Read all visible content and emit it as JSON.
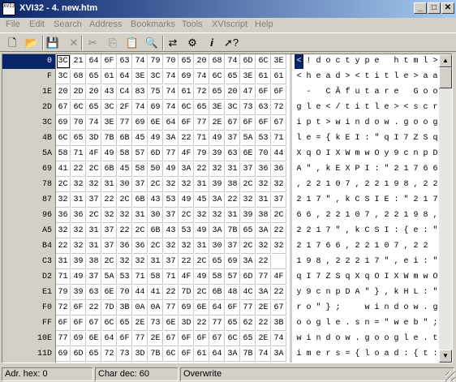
{
  "window": {
    "title": "XVI32 - 4. new.htm",
    "icon_text": "XVI32",
    "minimize_glyph": "_",
    "maximize_glyph": "□",
    "close_glyph": "✕"
  },
  "menu": [
    "File",
    "Edit",
    "Search",
    "Address",
    "Bookmarks",
    "Tools",
    "XVIscript",
    "Help"
  ],
  "toolbar": [
    {
      "name": "new-file-icon",
      "glyph": "🗋",
      "enabled": true
    },
    {
      "name": "open-folder-icon",
      "glyph": "📂",
      "enabled": true
    },
    {
      "name": "save-icon",
      "glyph": "💾",
      "enabled": true
    },
    {
      "name": "close-file-icon",
      "glyph": "✕",
      "enabled": false
    },
    {
      "name": "cut-icon",
      "glyph": "✂",
      "enabled": false
    },
    {
      "name": "copy-icon",
      "glyph": "⎘",
      "enabled": false
    },
    {
      "name": "paste-icon",
      "glyph": "📋",
      "enabled": true
    },
    {
      "name": "find-icon",
      "glyph": "🔍",
      "enabled": true
    },
    {
      "name": "replace-icon",
      "glyph": "⇄",
      "enabled": true
    },
    {
      "name": "settings-icon",
      "glyph": "⚙",
      "enabled": true
    },
    {
      "name": "info-icon",
      "glyph": "𝒊",
      "enabled": true
    },
    {
      "name": "context-help-icon",
      "glyph": "➚?",
      "enabled": true
    }
  ],
  "selection": {
    "row": 0,
    "col": 0
  },
  "rows": [
    {
      "addr": "0",
      "hex": [
        "3C",
        "21",
        "64",
        "6F",
        "63",
        "74",
        "79",
        "70",
        "65",
        "20",
        "68",
        "74",
        "6D",
        "6C",
        "3E"
      ],
      "text": [
        "<",
        "!",
        "d",
        "o",
        "c",
        "t",
        "y",
        "p",
        "e",
        " ",
        "h",
        "t",
        "m",
        "l",
        ">"
      ]
    },
    {
      "addr": "F",
      "hex": [
        "3C",
        "68",
        "65",
        "61",
        "64",
        "3E",
        "3C",
        "74",
        "69",
        "74",
        "6C",
        "65",
        "3E",
        "61",
        "61"
      ],
      "text": [
        "<",
        "h",
        "e",
        "a",
        "d",
        ">",
        "<",
        "t",
        "i",
        "t",
        "l",
        "e",
        ">",
        "a",
        "a"
      ]
    },
    {
      "addr": "1E",
      "hex": [
        "20",
        "2D",
        "20",
        "43",
        "C4",
        "83",
        "75",
        "74",
        "61",
        "72",
        "65",
        "20",
        "47",
        "6F",
        "6F"
      ],
      "text": [
        " ",
        "-",
        " ",
        "C",
        "Ă",
        "f",
        "u",
        "t",
        "a",
        "r",
        "e",
        " ",
        "G",
        "o",
        "o"
      ]
    },
    {
      "addr": "2D",
      "hex": [
        "67",
        "6C",
        "65",
        "3C",
        "2F",
        "74",
        "69",
        "74",
        "6C",
        "65",
        "3E",
        "3C",
        "73",
        "63",
        "72"
      ],
      "text": [
        "g",
        "l",
        "e",
        "<",
        "/",
        "t",
        "i",
        "t",
        "l",
        "e",
        ">",
        "<",
        "s",
        "c",
        "r"
      ]
    },
    {
      "addr": "3C",
      "hex": [
        "69",
        "70",
        "74",
        "3E",
        "77",
        "69",
        "6E",
        "64",
        "6F",
        "77",
        "2E",
        "67",
        "6F",
        "6F",
        "67"
      ],
      "text": [
        "i",
        "p",
        "t",
        ">",
        "w",
        "i",
        "n",
        "d",
        "o",
        "w",
        ".",
        "g",
        "o",
        "o",
        "g"
      ]
    },
    {
      "addr": "4B",
      "hex": [
        "6C",
        "65",
        "3D",
        "7B",
        "6B",
        "45",
        "49",
        "3A",
        "22",
        "71",
        "49",
        "37",
        "5A",
        "53",
        "71"
      ],
      "text": [
        "l",
        "e",
        "=",
        "{",
        "k",
        "E",
        "I",
        ":",
        "\"",
        "q",
        "I",
        "7",
        "Z",
        "S",
        "q"
      ]
    },
    {
      "addr": "5A",
      "hex": [
        "58",
        "71",
        "4F",
        "49",
        "58",
        "57",
        "6D",
        "77",
        "4F",
        "79",
        "39",
        "63",
        "6E",
        "70",
        "44"
      ],
      "text": [
        "X",
        "q",
        "O",
        "I",
        "X",
        "W",
        "m",
        "w",
        "O",
        "y",
        "9",
        "c",
        "n",
        "p",
        "D"
      ]
    },
    {
      "addr": "69",
      "hex": [
        "41",
        "22",
        "2C",
        "6B",
        "45",
        "58",
        "50",
        "49",
        "3A",
        "22",
        "32",
        "31",
        "37",
        "36",
        "36"
      ],
      "text": [
        "A",
        "\"",
        ",",
        "k",
        "E",
        "X",
        "P",
        "I",
        ":",
        "\"",
        "2",
        "1",
        "7",
        "6",
        "6"
      ]
    },
    {
      "addr": "78",
      "hex": [
        "2C",
        "32",
        "32",
        "31",
        "30",
        "37",
        "2C",
        "32",
        "32",
        "31",
        "39",
        "38",
        "2C",
        "32",
        "32"
      ],
      "text": [
        ",",
        "2",
        "2",
        "1",
        "0",
        "7",
        ",",
        "2",
        "2",
        "1",
        "9",
        "8",
        ",",
        "2",
        "2"
      ]
    },
    {
      "addr": "87",
      "hex": [
        "32",
        "31",
        "37",
        "22",
        "2C",
        "6B",
        "43",
        "53",
        "49",
        "45",
        "3A",
        "22",
        "32",
        "31",
        "37"
      ],
      "text": [
        "2",
        "1",
        "7",
        "\"",
        ",",
        "k",
        "C",
        "S",
        "I",
        "E",
        ":",
        "\"",
        "2",
        "1",
        "7"
      ]
    },
    {
      "addr": "96",
      "hex": [
        "36",
        "36",
        "2C",
        "32",
        "32",
        "31",
        "30",
        "37",
        "2C",
        "32",
        "32",
        "31",
        "39",
        "38",
        "2C"
      ],
      "text": [
        "6",
        "6",
        ",",
        "2",
        "2",
        "1",
        "0",
        "7",
        ",",
        "2",
        "2",
        "1",
        "9",
        "8",
        ","
      ]
    },
    {
      "addr": "A5",
      "hex": [
        "32",
        "32",
        "31",
        "37",
        "22",
        "2C",
        "6B",
        "43",
        "53",
        "49",
        "3A",
        "7B",
        "65",
        "3A",
        "22"
      ],
      "text": [
        "2",
        "2",
        "1",
        "7",
        "\"",
        ",",
        "k",
        "C",
        "S",
        "I",
        ":",
        "{",
        "e",
        ":",
        "\""
      ]
    },
    {
      "addr": "B4",
      "hex": [
        "22",
        "32",
        "31",
        "37",
        "36",
        "36",
        "2C",
        "32",
        "32",
        "31",
        "30",
        "37",
        "2C",
        "32",
        "32"
      ],
      "text": [
        "2",
        "1",
        "7",
        "6",
        "6",
        ",",
        "2",
        "2",
        "1",
        "0",
        "7",
        ",",
        "2",
        "2",
        " "
      ]
    },
    {
      "addr": "C3",
      "hex": [
        "31",
        "39",
        "38",
        "2C",
        "32",
        "32",
        "31",
        "37",
        "22",
        "2C",
        "65",
        "69",
        "3A",
        "22",
        " "
      ],
      "text": [
        "1",
        "9",
        "8",
        ",",
        "2",
        "2",
        "2",
        "1",
        "7",
        "\"",
        ",",
        "e",
        "i",
        ":",
        "\""
      ]
    },
    {
      "addr": "D2",
      "hex": [
        "71",
        "49",
        "37",
        "5A",
        "53",
        "71",
        "58",
        "71",
        "4F",
        "49",
        "58",
        "57",
        "6D",
        "77",
        "4F"
      ],
      "text": [
        "q",
        "I",
        "7",
        "Z",
        "S",
        "q",
        "X",
        "q",
        "O",
        "I",
        "X",
        "W",
        "m",
        "w",
        "O"
      ]
    },
    {
      "addr": "E1",
      "hex": [
        "79",
        "39",
        "63",
        "6E",
        "70",
        "44",
        "41",
        "22",
        "7D",
        "2C",
        "6B",
        "48",
        "4C",
        "3A",
        "22"
      ],
      "text": [
        "y",
        "9",
        "c",
        "n",
        "p",
        "D",
        "A",
        "\"",
        "}",
        ",",
        "k",
        "H",
        "L",
        ":",
        "\""
      ]
    },
    {
      "addr": "F0",
      "hex": [
        "72",
        "6F",
        "22",
        "7D",
        "3B",
        "0A",
        "0A",
        "77",
        "69",
        "6E",
        "64",
        "6F",
        "77",
        "2E",
        "67"
      ],
      "text": [
        "r",
        "o",
        "\"",
        "}",
        ";",
        " ",
        " ",
        "w",
        "i",
        "n",
        "d",
        "o",
        "w",
        ".",
        "g"
      ]
    },
    {
      "addr": "FF",
      "hex": [
        "6F",
        "6F",
        "67",
        "6C",
        "65",
        "2E",
        "73",
        "6E",
        "3D",
        "22",
        "77",
        "65",
        "62",
        "22",
        "3B"
      ],
      "text": [
        "o",
        "o",
        "g",
        "l",
        "e",
        ".",
        "s",
        "n",
        "=",
        "\"",
        "w",
        "e",
        "b",
        "\"",
        ";"
      ]
    },
    {
      "addr": "10E",
      "hex": [
        "77",
        "69",
        "6E",
        "64",
        "6F",
        "77",
        "2E",
        "67",
        "6F",
        "6F",
        "67",
        "6C",
        "65",
        "2E",
        "74"
      ],
      "text": [
        "w",
        "i",
        "n",
        "d",
        "o",
        "w",
        ".",
        "g",
        "o",
        "o",
        "g",
        "l",
        "e",
        ".",
        "t"
      ]
    },
    {
      "addr": "11D",
      "hex": [
        "69",
        "6D",
        "65",
        "72",
        "73",
        "3D",
        "7B",
        "6C",
        "6F",
        "61",
        "64",
        "3A",
        "7B",
        "74",
        "3A"
      ],
      "text": [
        "i",
        "m",
        "e",
        "r",
        "s",
        "=",
        "{",
        "l",
        "o",
        "a",
        "d",
        ":",
        "{",
        "t",
        ":"
      ]
    }
  ],
  "status": {
    "address": "Adr. hex: 0",
    "char": "Char dec: 60",
    "mode": "Overwrite"
  }
}
